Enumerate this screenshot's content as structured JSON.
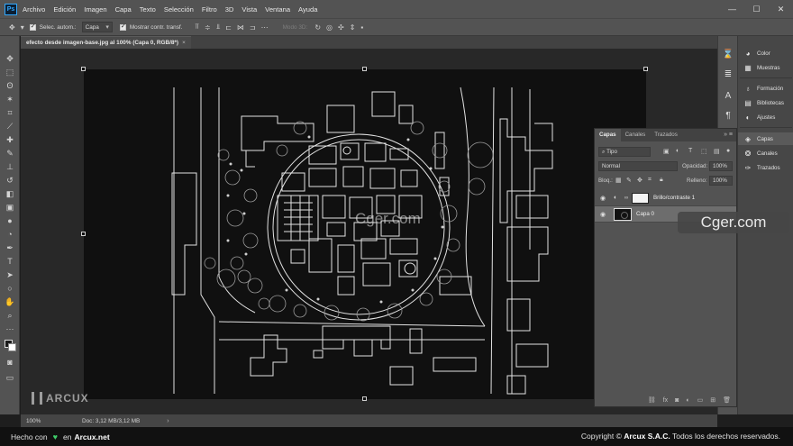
{
  "menubar": {
    "app_icon": "Ps",
    "items": [
      "Archivo",
      "Edición",
      "Imagen",
      "Capa",
      "Texto",
      "Selección",
      "Filtro",
      "3D",
      "Vista",
      "Ventana",
      "Ayuda"
    ],
    "window_controls": [
      "—",
      "☐",
      "✕"
    ]
  },
  "options": {
    "auto_select_label": "Selec. autom.:",
    "auto_select_value": "Capa",
    "show_transform_label": "Mostrar contr. transf.",
    "mode_3d_label": "Modo 3D:"
  },
  "document": {
    "tab_title": "efecto desde imagen-base.jpg al 100% (Capa 0, RGB/8*)",
    "tab_close": "×"
  },
  "status": {
    "zoom": "100%",
    "doc_info": "Doc: 3,12 MB/3,12 MB",
    "arrow": "›"
  },
  "right_panels": {
    "group1": [
      "Color",
      "Muestras"
    ],
    "group2": [
      "Formación",
      "Bibliotecas",
      "Ajustes"
    ],
    "group3": [
      "Capas",
      "Canales",
      "Trazados"
    ],
    "active": "Capas"
  },
  "layers_panel": {
    "tabs": [
      "Capas",
      "Canales",
      "Trazados"
    ],
    "filter_label": "Tipo",
    "blend_mode": "Normal",
    "opacity_label": "Opacidad:",
    "opacity_value": "100%",
    "lock_label": "Bloq.:",
    "fill_label": "Relleno:",
    "fill_value": "100%",
    "layers": [
      {
        "name": "Brillo/contraste 1",
        "type": "adjustment",
        "visible": true,
        "selected": false
      },
      {
        "name": "Capa 0",
        "type": "image",
        "visible": true,
        "selected": true
      }
    ],
    "footer_icons": [
      "link-icon",
      "fx-icon",
      "mask-icon",
      "adjustment-icon",
      "group-icon",
      "new-layer-icon",
      "trash-icon"
    ]
  },
  "watermarks": {
    "arcux": "ARCUX",
    "cger_canvas": "Cger.com",
    "cger_badge": "Cger.com"
  },
  "footer": {
    "made_with": "Hecho con",
    "in_label": "en",
    "site": "Arcux.net",
    "copyright_prefix": "Copyright ©",
    "company": "Arcux S.A.C.",
    "rights": "Todos los derechos reservados."
  },
  "colors": {
    "chrome": "#535353",
    "workspace": "#282828",
    "canvas": "#101010",
    "ps_accent": "#31a8ff",
    "heart": "#3fce6a"
  }
}
